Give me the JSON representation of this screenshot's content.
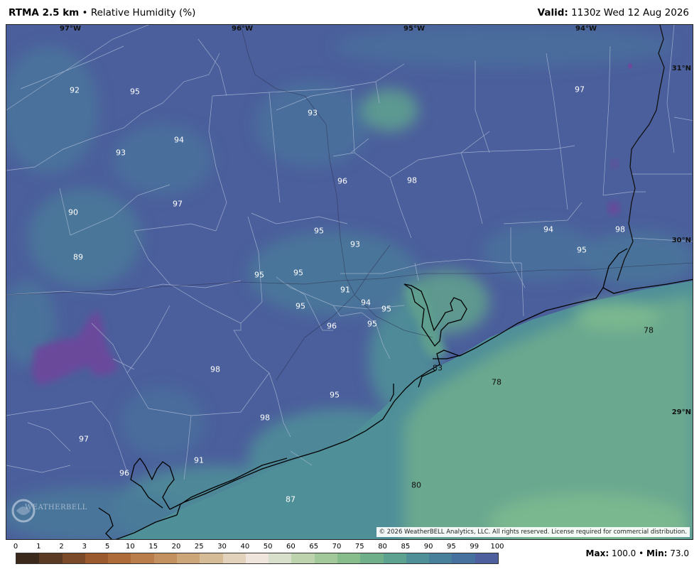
{
  "header": {
    "product": "RTMA 2.5 km",
    "bullet": "•",
    "field": "Relative Humidity (%)",
    "valid_label": "Valid:",
    "valid_time": "1130z Wed 12 Aug 2026"
  },
  "map": {
    "longitudes": [
      "97°W",
      "96°W",
      "95°W",
      "94°W"
    ],
    "latitudes": [
      "31°N",
      "30°N",
      "29°N"
    ],
    "values": [
      {
        "text": "92",
        "dark": false
      },
      {
        "text": "95",
        "dark": false
      },
      {
        "text": "93",
        "dark": false
      },
      {
        "text": "97",
        "dark": false
      },
      {
        "text": "94",
        "dark": false
      },
      {
        "text": "93",
        "dark": false
      },
      {
        "text": "96",
        "dark": false
      },
      {
        "text": "98",
        "dark": false
      },
      {
        "text": "90",
        "dark": false
      },
      {
        "text": "97",
        "dark": false
      },
      {
        "text": "95",
        "dark": false
      },
      {
        "text": "93",
        "dark": false
      },
      {
        "text": "94",
        "dark": false
      },
      {
        "text": "98",
        "dark": false
      },
      {
        "text": "89",
        "dark": false
      },
      {
        "text": "95",
        "dark": false
      },
      {
        "text": "95",
        "dark": false
      },
      {
        "text": "95",
        "dark": false
      },
      {
        "text": "91",
        "dark": false
      },
      {
        "text": "94",
        "dark": false
      },
      {
        "text": "95",
        "dark": false
      },
      {
        "text": "95",
        "dark": false
      },
      {
        "text": "96",
        "dark": false
      },
      {
        "text": "95",
        "dark": false
      },
      {
        "text": "78",
        "dark": true
      },
      {
        "text": "98",
        "dark": false
      },
      {
        "text": "83",
        "dark": true
      },
      {
        "text": "78",
        "dark": true
      },
      {
        "text": "95",
        "dark": false
      },
      {
        "text": "98",
        "dark": false
      },
      {
        "text": "97",
        "dark": false
      },
      {
        "text": "91",
        "dark": false
      },
      {
        "text": "96",
        "dark": false
      },
      {
        "text": "80",
        "dark": true
      },
      {
        "text": "87",
        "dark": false
      }
    ],
    "copyright": "© 2026 WeatherBELL Analytics, LLC. All rights reserved. License required for commercial distribution.",
    "logo_text": "WEATHERBELL"
  },
  "legend": {
    "labels": [
      "0",
      "1",
      "2",
      "3",
      "5",
      "10",
      "15",
      "20",
      "25",
      "30",
      "40",
      "50",
      "60",
      "65",
      "70",
      "75",
      "80",
      "85",
      "90",
      "95",
      "99",
      "100"
    ],
    "colors": [
      "#3b2a1c",
      "#5a3a22",
      "#7b4a28",
      "#9a5a2e",
      "#ad6b3a",
      "#b97d4b",
      "#c39160",
      "#cca579",
      "#d6bb97",
      "#e3d2bb",
      "#efe5dc",
      "#d8e0cc",
      "#bcd3ae",
      "#a2c99a",
      "#86bd8a",
      "#6fb08a",
      "#5da191",
      "#4f8f98",
      "#48809c",
      "#46709d",
      "#4e5f9e",
      "#6a4a9b"
    ]
  },
  "stats": {
    "max_label": "Max:",
    "max_value": "100.0",
    "bullet": "•",
    "min_label": "Min:",
    "min_value": "73.0"
  }
}
